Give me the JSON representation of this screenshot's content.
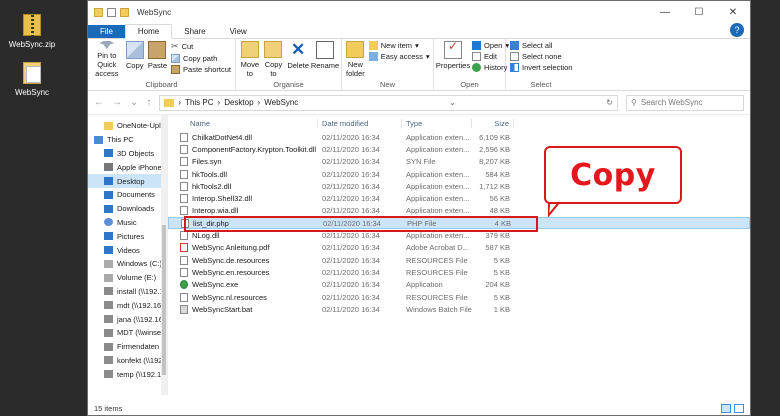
{
  "desktop": [
    {
      "label": "WebSync.zip",
      "icon": "zip-folder-icon"
    },
    {
      "label": "WebSync",
      "icon": "folder-icon"
    }
  ],
  "window": {
    "title": "WebSync",
    "controls": {
      "minimize": "—",
      "maximize": "☐",
      "close": "✕"
    }
  },
  "tabs": [
    "File",
    "Home",
    "Share",
    "View"
  ],
  "ribbon": {
    "clipboard": {
      "name": "Clipboard",
      "pin": "Pin to Quick access",
      "copy": "Copy",
      "paste": "Paste",
      "cut": "Cut",
      "copy_path": "Copy path",
      "paste_shortcut": "Paste shortcut"
    },
    "organise": {
      "name": "Organise",
      "move_to": "Move to",
      "copy_to": "Copy to",
      "delete": "Delete",
      "rename": "Rename"
    },
    "new": {
      "name": "New",
      "new_folder": "New folder",
      "new_item": "New item",
      "easy_access": "Easy access"
    },
    "open": {
      "name": "Open",
      "properties": "Properties",
      "open": "Open",
      "edit": "Edit",
      "history": "History"
    },
    "select": {
      "name": "Select",
      "select_all": "Select all",
      "select_none": "Select none",
      "invert": "Invert selection"
    }
  },
  "address": {
    "path": [
      "This PC",
      "Desktop",
      "WebSync"
    ],
    "search_placeholder": "Search WebSync"
  },
  "nav_pane": [
    {
      "label": "OneNote-Uploa",
      "icon": "folder",
      "level": 1
    },
    {
      "label": "This PC",
      "icon": "pc",
      "level": 0
    },
    {
      "label": "3D Objects",
      "icon": "blue",
      "level": 1
    },
    {
      "label": "Apple iPhone",
      "icon": "phone",
      "level": 1
    },
    {
      "label": "Desktop",
      "icon": "blue",
      "level": 1,
      "selected": true
    },
    {
      "label": "Documents",
      "icon": "blue",
      "level": 1
    },
    {
      "label": "Downloads",
      "icon": "blue",
      "level": 1
    },
    {
      "label": "Music",
      "icon": "music",
      "level": 1
    },
    {
      "label": "Pictures",
      "icon": "blue",
      "level": 1
    },
    {
      "label": "Videos",
      "icon": "blue",
      "level": 1
    },
    {
      "label": "Windows (C:)",
      "icon": "drive",
      "level": 1
    },
    {
      "label": "Volume (E:)",
      "icon": "drive",
      "level": 1
    },
    {
      "label": "install (\\\\192.168.2",
      "icon": "net2",
      "level": 1
    },
    {
      "label": "mdt (\\\\192.168.2",
      "icon": "net2",
      "level": 1
    },
    {
      "label": "jana (\\\\192.168.2",
      "icon": "net2",
      "level": 1
    },
    {
      "label": "MDT (\\\\winserve",
      "icon": "net2",
      "level": 1
    },
    {
      "label": "Firmendaten (\\\\",
      "icon": "net2",
      "level": 1
    },
    {
      "label": "konfekt (\\\\192.16",
      "icon": "net2",
      "level": 1
    },
    {
      "label": "temp (\\\\192.168.2",
      "icon": "net2",
      "level": 1
    },
    {
      "label": "",
      "icon": "none",
      "level": 1
    },
    {
      "label": "Network",
      "icon": "net",
      "level": 0
    }
  ],
  "columns": {
    "name": "Name",
    "date": "Date modified",
    "type": "Type",
    "size": "Size"
  },
  "files": [
    {
      "name": "ChilkatDotNet4.dll",
      "date": "02/11/2020 16:34",
      "type": "Application exten...",
      "size": "6,109 KB",
      "icon": "dll"
    },
    {
      "name": "ComponentFactory.Krypton.Toolkit.dll",
      "date": "02/11/2020 16:34",
      "type": "Application exten...",
      "size": "2,596 KB",
      "icon": "dll"
    },
    {
      "name": "Files.syn",
      "date": "02/11/2020 16:34",
      "type": "SYN File",
      "size": "8,207 KB",
      "icon": "file"
    },
    {
      "name": "hkTools.dll",
      "date": "02/11/2020 16:34",
      "type": "Application exten...",
      "size": "584 KB",
      "icon": "dll"
    },
    {
      "name": "hkTools2.dll",
      "date": "02/11/2020 16:34",
      "type": "Application exten...",
      "size": "1,712 KB",
      "icon": "dll"
    },
    {
      "name": "Interop.Shell32.dll",
      "date": "02/11/2020 16:34",
      "type": "Application exten...",
      "size": "56 KB",
      "icon": "dll"
    },
    {
      "name": "Interop.wia.dll",
      "date": "02/11/2020 16:34",
      "type": "Application exten...",
      "size": "48 KB",
      "icon": "dll"
    },
    {
      "name": "list_dir.php",
      "date": "02/11/2020 16:34",
      "type": "PHP File",
      "size": "4 KB",
      "icon": "file",
      "selected": true
    },
    {
      "name": "NLog.dll",
      "date": "02/11/2020 16:34",
      "type": "Application exten...",
      "size": "379 KB",
      "icon": "dll"
    },
    {
      "name": "WebSync Anleitung.pdf",
      "date": "02/11/2020 16:34",
      "type": "Adobe Acrobat D...",
      "size": "587 KB",
      "icon": "pdf"
    },
    {
      "name": "WebSync.de.resources",
      "date": "02/11/2020 16:34",
      "type": "RESOURCES File",
      "size": "5 KB",
      "icon": "file"
    },
    {
      "name": "WebSync.en.resources",
      "date": "02/11/2020 16:34",
      "type": "RESOURCES File",
      "size": "5 KB",
      "icon": "file"
    },
    {
      "name": "WebSync.exe",
      "date": "02/11/2020 16:34",
      "type": "Application",
      "size": "204 KB",
      "icon": "exe"
    },
    {
      "name": "WebSync.nl.resources",
      "date": "02/11/2020 16:34",
      "type": "RESOURCES File",
      "size": "5 KB",
      "icon": "file"
    },
    {
      "name": "WebSyncStart.bat",
      "date": "02/11/2020 16:34",
      "type": "Windows Batch File",
      "size": "1 KB",
      "icon": "bat"
    }
  ],
  "annotation": {
    "callout_text": "Copy",
    "color": "#d7191c"
  },
  "status": {
    "item_count": "15 items"
  }
}
